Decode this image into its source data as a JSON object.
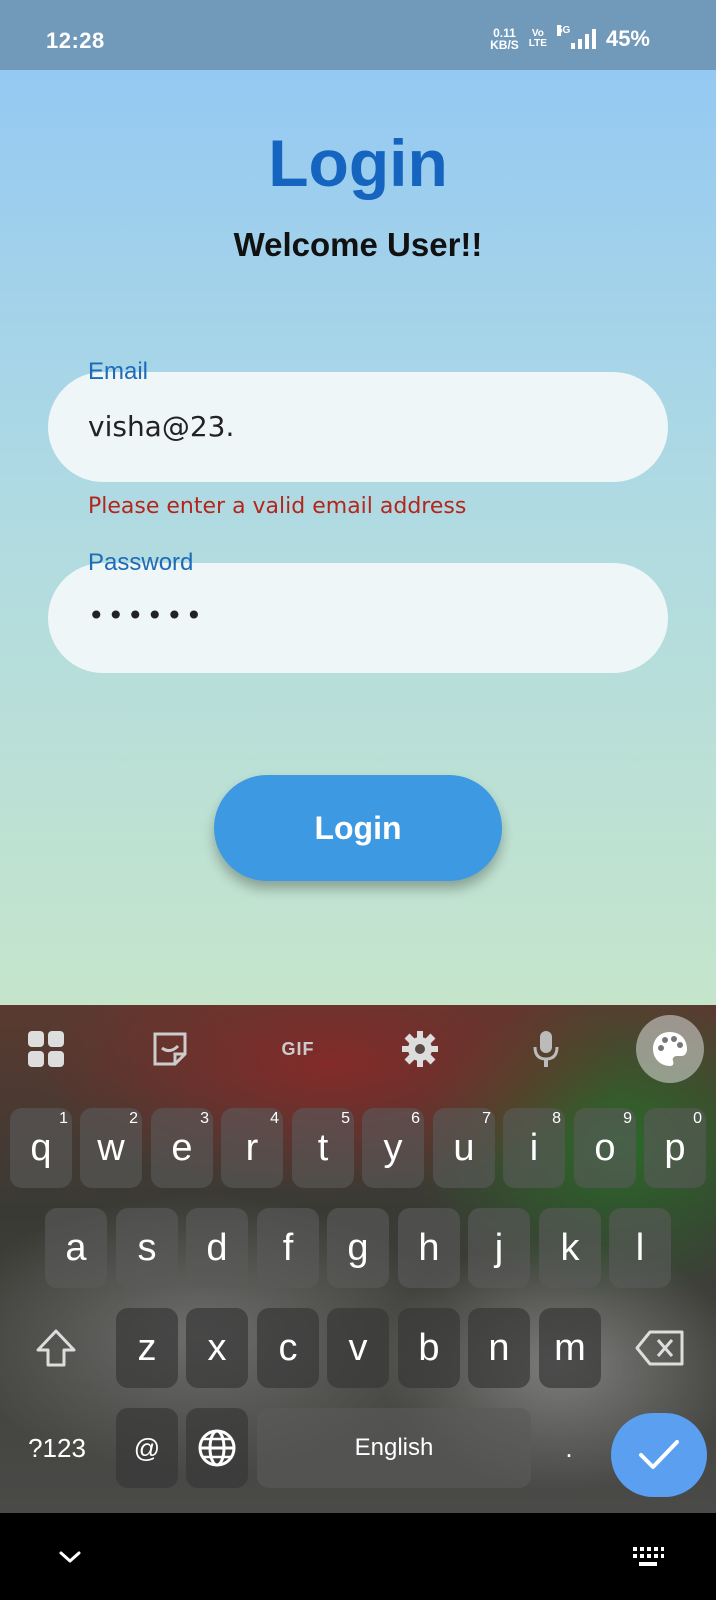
{
  "status_bar": {
    "time": "12:28",
    "net_speed_value": "0.11",
    "net_speed_unit": "KB/S",
    "volte_top": "Vo",
    "volte_bottom": "LTE",
    "network_type": "5G",
    "battery": "45%"
  },
  "app": {
    "title": "Login",
    "subtitle": "Welcome User!!",
    "email": {
      "label": "Email",
      "value": "visha@23.",
      "error": "Please enter a valid email address"
    },
    "password": {
      "label": "Password",
      "value": "••••••"
    },
    "login_button": "Login"
  },
  "keyboard": {
    "toolbar_icons": [
      "apps-grid-icon",
      "sticker-icon",
      "gif-icon",
      "settings-gear-icon",
      "microphone-icon",
      "palette-icon"
    ],
    "gif_label": "GIF",
    "row1": [
      {
        "key": "q",
        "hint": "1"
      },
      {
        "key": "w",
        "hint": "2"
      },
      {
        "key": "e",
        "hint": "3"
      },
      {
        "key": "r",
        "hint": "4"
      },
      {
        "key": "t",
        "hint": "5"
      },
      {
        "key": "y",
        "hint": "6"
      },
      {
        "key": "u",
        "hint": "7"
      },
      {
        "key": "i",
        "hint": "8"
      },
      {
        "key": "o",
        "hint": "9"
      },
      {
        "key": "p",
        "hint": "0"
      }
    ],
    "row2": [
      "a",
      "s",
      "d",
      "f",
      "g",
      "h",
      "j",
      "k",
      "l"
    ],
    "row3": [
      "z",
      "x",
      "c",
      "v",
      "b",
      "n",
      "m"
    ],
    "symbols_key": "?123",
    "at_key": "@",
    "space_label": "English",
    "period_key": "."
  },
  "colors": {
    "title": "#1565c0",
    "error": "#b3261e",
    "login_button": "#3d9ae2",
    "enter_key": "#5a9ff0",
    "status_bar": "#7099ba"
  }
}
